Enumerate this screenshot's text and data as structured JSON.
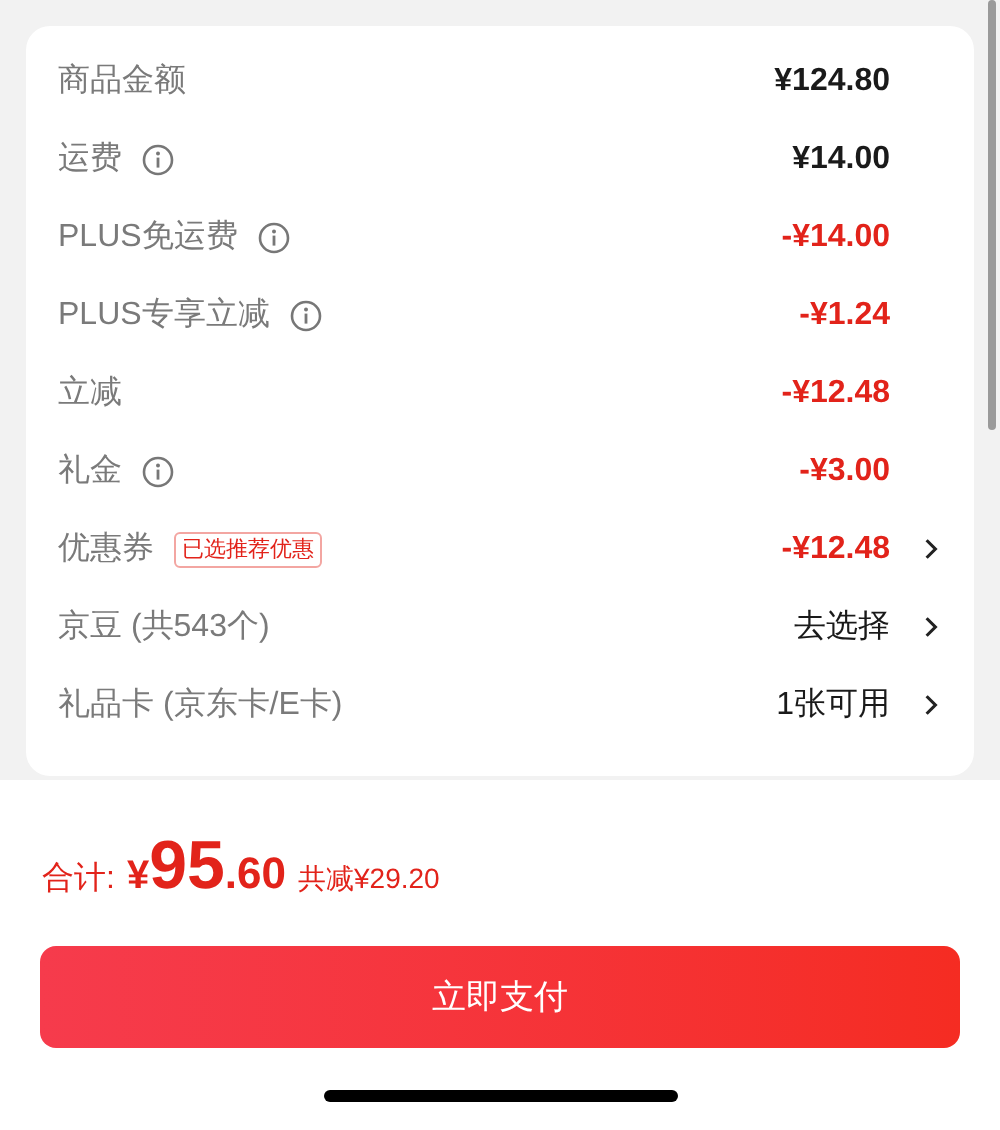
{
  "summary": {
    "rows": [
      {
        "label": "商品金额",
        "info": false,
        "value": "¥124.80",
        "kind": "amount",
        "arrow": false
      },
      {
        "label": "运费",
        "info": true,
        "value": "¥14.00",
        "kind": "amount",
        "arrow": false
      },
      {
        "label": "PLUS免运费",
        "info": true,
        "value": "-¥14.00",
        "kind": "discount",
        "arrow": false
      },
      {
        "label": "PLUS专享立减",
        "info": true,
        "value": "-¥1.24",
        "kind": "discount",
        "arrow": false
      },
      {
        "label": "立减",
        "info": false,
        "value": "-¥12.48",
        "kind": "discount",
        "arrow": false
      },
      {
        "label": "礼金",
        "info": true,
        "value": "-¥3.00",
        "kind": "discount",
        "arrow": false
      },
      {
        "label": "优惠券",
        "info": false,
        "tag": "已选推荐优惠",
        "value": "-¥12.48",
        "kind": "discount",
        "arrow": true
      },
      {
        "label": "京豆 (共543个)",
        "info": false,
        "value": "去选择",
        "kind": "amount",
        "arrow": true
      },
      {
        "label": "礼品卡 (京东卡/E卡)",
        "info": false,
        "value": "1张可用",
        "kind": "amount",
        "arrow": true
      }
    ]
  },
  "total": {
    "label": "合计:",
    "currency": "¥",
    "integer": "95",
    "decimal": ".60",
    "saved": "共减¥29.20"
  },
  "pay_button": "立即支付"
}
